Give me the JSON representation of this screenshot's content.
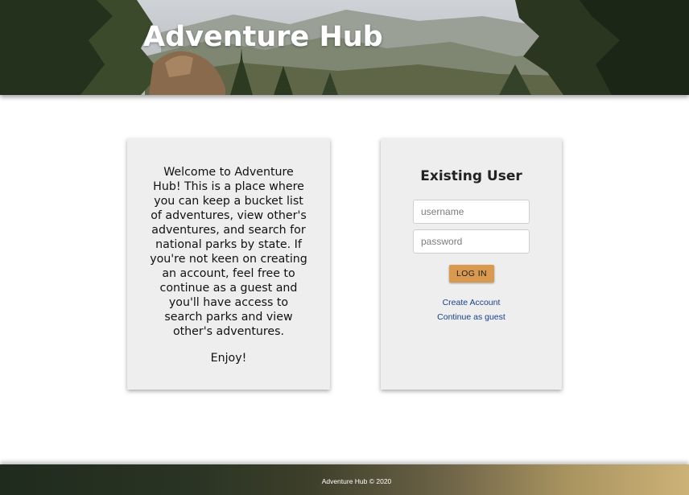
{
  "header": {
    "title": "Adventure Hub"
  },
  "welcome": {
    "text": "Welcome to Adventure Hub! This is a place where you can keep a bucket list of adventures, view other's adventures, and search for national parks by state. If you're not keen on creating an account, feel free to continue as a guest and you'll have access to search parks and view other's adventures.",
    "closing": "Enjoy!"
  },
  "login": {
    "title": "Existing User",
    "username_placeholder": "username",
    "password_placeholder": "password",
    "login_button": "LOG IN",
    "create_account_link": "Create Account",
    "guest_link": "Continue as guest"
  },
  "footer": {
    "text": "Adventure Hub © 2020"
  },
  "colors": {
    "card_background": "#eeeeee",
    "login_button": "#d99a50",
    "link": "#1a3f8a"
  }
}
